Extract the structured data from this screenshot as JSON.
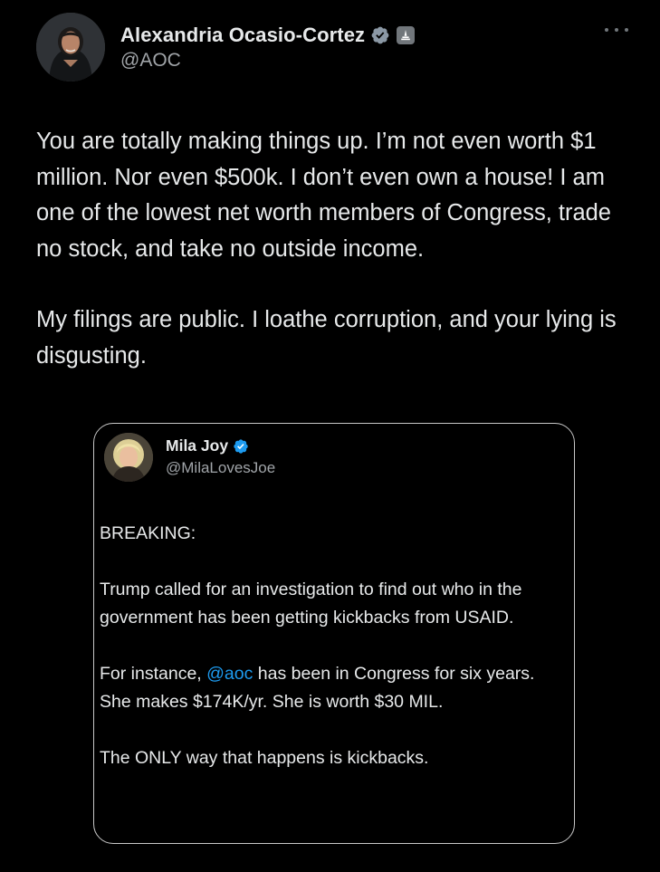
{
  "author": {
    "name": "Alexandria Ocasio-Cortez",
    "handle": "@AOC",
    "verified_icon": "verified-badge-icon",
    "gov_icon": "government-capitol-icon"
  },
  "tweet": {
    "paragraphs": [
      "You are totally making things up. I’m not even worth $1 million. Nor even $500k. I don’t even own a house! I am one of the lowest net worth members of Congress, trade no stock, and take no outside income.",
      "My filings are public. I loathe corruption, and your lying is disgusting."
    ]
  },
  "quote": {
    "name": "Mila Joy",
    "handle": "@MilaLovesJoe",
    "verified_icon": "verified-badge-icon",
    "p1": "BREAKING:",
    "p2": "Trump called for an investigation to find out who in the government has been getting kickbacks from USAID.",
    "p3_before": "For instance, ",
    "p3_mention": "@aoc",
    "p3_after": " has been in Congress for six years.  She makes $174K/yr.  She is worth $30 MIL.",
    "p4": "The ONLY way that happens is kickbacks."
  },
  "colors": {
    "background": "#000000",
    "text": "#e7e9ea",
    "secondary": "#a0a4a8",
    "verified_blue": "#1d9bf0",
    "mention": "#1d9bf0"
  }
}
